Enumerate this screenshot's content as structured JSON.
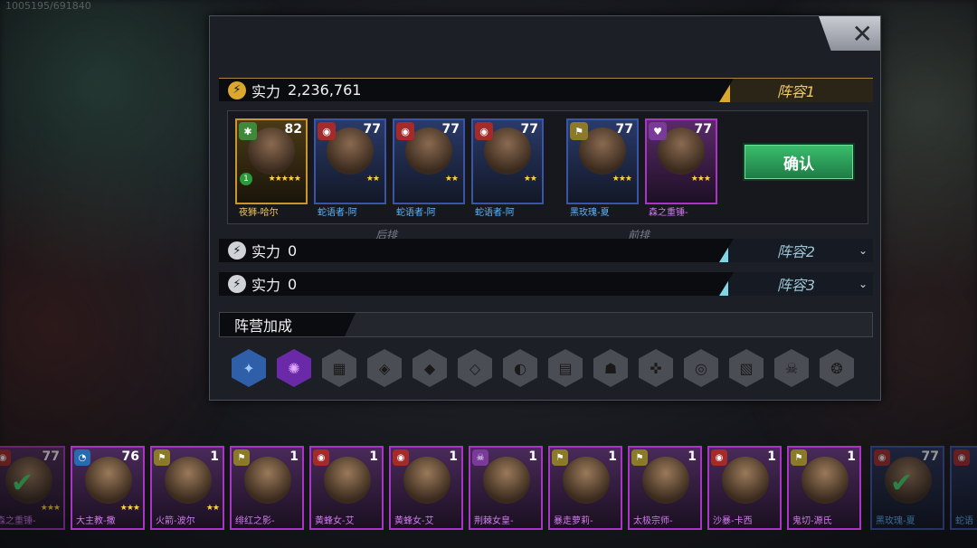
{
  "user_id": "1005195/691840",
  "modal": {
    "close_label": "✕",
    "lineups": [
      {
        "power_label": "实力",
        "power_value": "2,236,761",
        "name": "阵容1",
        "state": "expanded"
      },
      {
        "power_label": "实力",
        "power_value": "0",
        "name": "阵容2",
        "state": "collapsed"
      },
      {
        "power_label": "实力",
        "power_value": "0",
        "name": "阵容3",
        "state": "collapsed"
      }
    ],
    "back_row_label": "后排",
    "front_row_label": "前排",
    "confirm_label": "确认",
    "heroes": [
      {
        "name": "夜狮-哈尔",
        "level": "82",
        "stars": "★★★★★",
        "rank": "1",
        "faction": "green-icon",
        "rarity": "gold"
      },
      {
        "name": "蛇语者-阿",
        "level": "77",
        "stars": "★★",
        "faction": "red-icon",
        "rarity": "blue"
      },
      {
        "name": "蛇语者-阿",
        "level": "77",
        "stars": "★★",
        "faction": "red-icon",
        "rarity": "blue"
      },
      {
        "name": "蛇语者-阿",
        "level": "77",
        "stars": "★★",
        "faction": "red-icon",
        "rarity": "blue"
      },
      {
        "name": "黑玫瑰-夏",
        "level": "77",
        "stars": "★★★",
        "faction": "gold-icon",
        "rarity": "blue"
      },
      {
        "name": "森之重锤-",
        "level": "77",
        "stars": "★★★",
        "faction": "purple-icon",
        "rarity": "purple"
      }
    ],
    "faction_bonus_label": "阵营加成"
  },
  "roster": [
    {
      "name": "森之重锤-",
      "level": "77",
      "stars": "★★★",
      "selected": true,
      "rarity": "purple"
    },
    {
      "name": "大主教-撒",
      "level": "76",
      "stars": "★★★",
      "selected": false,
      "rarity": "purple"
    },
    {
      "name": "火箭-波尔",
      "level": "1",
      "stars": "★★",
      "selected": false,
      "rarity": "purple"
    },
    {
      "name": "绯红之影-",
      "level": "1",
      "stars": "",
      "selected": false,
      "rarity": "purple"
    },
    {
      "name": "黄蜂女-艾",
      "level": "1",
      "stars": "",
      "selected": false,
      "rarity": "purple"
    },
    {
      "name": "黄蜂女-艾",
      "level": "1",
      "stars": "",
      "selected": false,
      "rarity": "purple"
    },
    {
      "name": "荆棘女皇-",
      "level": "1",
      "stars": "",
      "selected": false,
      "rarity": "purple"
    },
    {
      "name": "暴走萝莉-",
      "level": "1",
      "stars": "",
      "selected": false,
      "rarity": "purple"
    },
    {
      "name": "太极宗师-",
      "level": "1",
      "stars": "",
      "selected": false,
      "rarity": "purple"
    },
    {
      "name": "沙暴-卡西",
      "level": "1",
      "stars": "",
      "selected": false,
      "rarity": "purple"
    },
    {
      "name": "鬼切-源氏",
      "level": "1",
      "stars": "",
      "selected": false,
      "rarity": "purple"
    },
    {
      "name": "黑玫瑰-夏",
      "level": "77",
      "stars": "",
      "selected": true,
      "rarity": "blue"
    },
    {
      "name": "蛇语",
      "level": "",
      "stars": "",
      "selected": false,
      "rarity": "blue"
    }
  ]
}
